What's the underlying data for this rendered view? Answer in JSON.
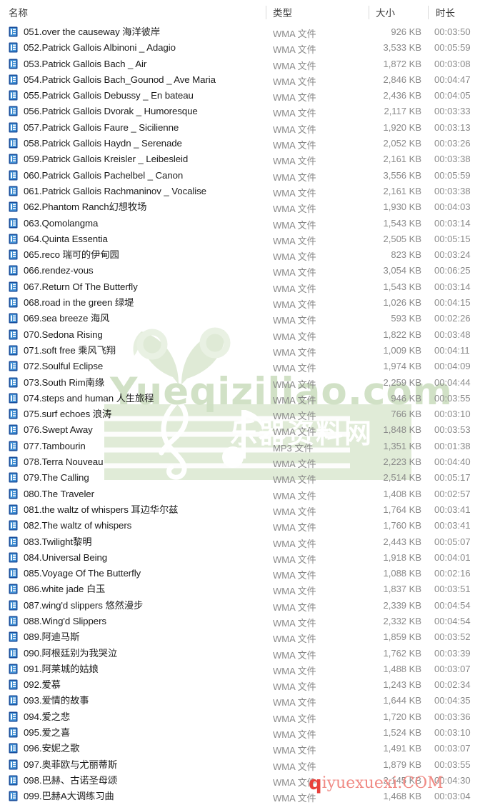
{
  "columns": {
    "name": "名称",
    "type": "类型",
    "size": "大小",
    "duration": "时长"
  },
  "icons": {
    "file": "wma-file-icon"
  },
  "colors": {
    "icon_blue_dark": "#1b4f9c",
    "icon_blue_light": "#4f9be0",
    "text_primary": "#1c1c1c",
    "text_secondary": "#8a8a8a",
    "watermark_green": "#cfe0c4",
    "watermark_band": "#dae7d0",
    "watermark_red": "#e8413c"
  },
  "watermark": {
    "center_text": "Yueqiziliao.com",
    "center_text_cn": "乐器资料网",
    "bottom_prefix": "q",
    "bottom_text": "iyuexuexi.COM"
  },
  "rows": [
    {
      "name": "051.over the causeway 海洋彼岸",
      "type": "WMA 文件",
      "size": "926 KB",
      "duration": "00:03:50"
    },
    {
      "name": "052.Patrick Gallois Albinoni _ Adagio",
      "type": "WMA 文件",
      "size": "3,533 KB",
      "duration": "00:05:59"
    },
    {
      "name": "053.Patrick Gallois Bach _ Air",
      "type": "WMA 文件",
      "size": "1,872 KB",
      "duration": "00:03:08"
    },
    {
      "name": "054.Patrick Gallois Bach_Gounod _ Ave Maria",
      "type": "WMA 文件",
      "size": "2,846 KB",
      "duration": "00:04:47"
    },
    {
      "name": "055.Patrick Gallois Debussy _ En bateau",
      "type": "WMA 文件",
      "size": "2,436 KB",
      "duration": "00:04:05"
    },
    {
      "name": "056.Patrick Gallois Dvorak _ Humoresque",
      "type": "WMA 文件",
      "size": "2,117 KB",
      "duration": "00:03:33"
    },
    {
      "name": "057.Patrick Gallois Faure _ Sicilienne",
      "type": "WMA 文件",
      "size": "1,920 KB",
      "duration": "00:03:13"
    },
    {
      "name": "058.Patrick Gallois Haydn _ Serenade",
      "type": "WMA 文件",
      "size": "2,052 KB",
      "duration": "00:03:26"
    },
    {
      "name": "059.Patrick Gallois Kreisler _ Leibesleid",
      "type": "WMA 文件",
      "size": "2,161 KB",
      "duration": "00:03:38"
    },
    {
      "name": "060.Patrick Gallois Pachelbel _ Canon",
      "type": "WMA 文件",
      "size": "3,556 KB",
      "duration": "00:05:59"
    },
    {
      "name": "061.Patrick Gallois Rachmaninov _ Vocalise",
      "type": "WMA 文件",
      "size": "2,161 KB",
      "duration": "00:03:38"
    },
    {
      "name": "062.Phantom Ranch幻想牧场",
      "type": "WMA 文件",
      "size": "1,930 KB",
      "duration": "00:04:03"
    },
    {
      "name": "063.Qomolangma",
      "type": "WMA 文件",
      "size": "1,543 KB",
      "duration": "00:03:14"
    },
    {
      "name": "064.Quinta Essentia",
      "type": "WMA 文件",
      "size": "2,505 KB",
      "duration": "00:05:15"
    },
    {
      "name": "065.reco 瑞可的伊甸园",
      "type": "WMA 文件",
      "size": "823 KB",
      "duration": "00:03:24"
    },
    {
      "name": "066.rendez-vous",
      "type": "WMA 文件",
      "size": "3,054 KB",
      "duration": "00:06:25"
    },
    {
      "name": "067.Return Of The Butterfly",
      "type": "WMA 文件",
      "size": "1,543 KB",
      "duration": "00:03:14"
    },
    {
      "name": "068.road in the green 绿堤",
      "type": "WMA 文件",
      "size": "1,026 KB",
      "duration": "00:04:15"
    },
    {
      "name": "069.sea breeze 海风",
      "type": "WMA 文件",
      "size": "593 KB",
      "duration": "00:02:26"
    },
    {
      "name": "070.Sedona Rising",
      "type": "WMA 文件",
      "size": "1,822 KB",
      "duration": "00:03:48"
    },
    {
      "name": "071.soft free 乘风飞翔",
      "type": "WMA 文件",
      "size": "1,009 KB",
      "duration": "00:04:11"
    },
    {
      "name": "072.Soulful Eclipse",
      "type": "WMA 文件",
      "size": "1,974 KB",
      "duration": "00:04:09"
    },
    {
      "name": "073.South Rim南缘",
      "type": "WMA 文件",
      "size": "2,259 KB",
      "duration": "00:04:44"
    },
    {
      "name": "074.steps and human 人生旅程",
      "type": "WMA 文件",
      "size": "946 KB",
      "duration": "00:03:55"
    },
    {
      "name": "075.surf echoes 浪涛",
      "type": "WMA 文件",
      "size": "766 KB",
      "duration": "00:03:10"
    },
    {
      "name": "076.Swept Away",
      "type": "WMA 文件",
      "size": "1,848 KB",
      "duration": "00:03:53"
    },
    {
      "name": "077.Tambourin",
      "type": "MP3 文件",
      "size": "1,351 KB",
      "duration": "00:01:38"
    },
    {
      "name": "078.Terra Nouveau",
      "type": "WMA 文件",
      "size": "2,223 KB",
      "duration": "00:04:40"
    },
    {
      "name": "079.The Calling",
      "type": "WMA 文件",
      "size": "2,514 KB",
      "duration": "00:05:17"
    },
    {
      "name": "080.The Traveler",
      "type": "WMA 文件",
      "size": "1,408 KB",
      "duration": "00:02:57"
    },
    {
      "name": "081.the waltz of whispers 耳边华尔兹",
      "type": "WMA 文件",
      "size": "1,764 KB",
      "duration": "00:03:41"
    },
    {
      "name": "082.The waltz of whispers",
      "type": "WMA 文件",
      "size": "1,760 KB",
      "duration": "00:03:41"
    },
    {
      "name": "083.Twilight黎明",
      "type": "WMA 文件",
      "size": "2,443 KB",
      "duration": "00:05:07"
    },
    {
      "name": "084.Universal Being",
      "type": "WMA 文件",
      "size": "1,918 KB",
      "duration": "00:04:01"
    },
    {
      "name": "085.Voyage Of The Butterfly",
      "type": "WMA 文件",
      "size": "1,088 KB",
      "duration": "00:02:16"
    },
    {
      "name": "086.white jade 白玉",
      "type": "WMA 文件",
      "size": "1,837 KB",
      "duration": "00:03:51"
    },
    {
      "name": "087.wing'd slippers 悠然漫步",
      "type": "WMA 文件",
      "size": "2,339 KB",
      "duration": "00:04:54"
    },
    {
      "name": "088.Wing'd Slippers",
      "type": "WMA 文件",
      "size": "2,332 KB",
      "duration": "00:04:54"
    },
    {
      "name": "089.阿迪马斯",
      "type": "WMA 文件",
      "size": "1,859 KB",
      "duration": "00:03:52"
    },
    {
      "name": "090.阿根廷别为我哭泣",
      "type": "WMA 文件",
      "size": "1,762 KB",
      "duration": "00:03:39"
    },
    {
      "name": "091.阿莱城的姑娘",
      "type": "WMA 文件",
      "size": "1,488 KB",
      "duration": "00:03:07"
    },
    {
      "name": "092.爱慕",
      "type": "WMA 文件",
      "size": "1,243 KB",
      "duration": "00:02:34"
    },
    {
      "name": "093.爱情的故事",
      "type": "WMA 文件",
      "size": "1,644 KB",
      "duration": "00:04:35"
    },
    {
      "name": "094.爱之悲",
      "type": "WMA 文件",
      "size": "1,720 KB",
      "duration": "00:03:36"
    },
    {
      "name": "095.爱之喜",
      "type": "WMA 文件",
      "size": "1,524 KB",
      "duration": "00:03:10"
    },
    {
      "name": "096.安妮之歌",
      "type": "WMA 文件",
      "size": "1,491 KB",
      "duration": "00:03:07"
    },
    {
      "name": "097.奥菲欧与尤丽蒂斯",
      "type": "WMA 文件",
      "size": "1,879 KB",
      "duration": "00:03:55"
    },
    {
      "name": "098.巴赫、古诺圣母颂",
      "type": "WMA 文件",
      "size": "2,145 KB",
      "duration": "00:04:30"
    },
    {
      "name": "099.巴赫A大调练习曲",
      "type": "WMA 文件",
      "size": "1,468 KB",
      "duration": "00:03:04"
    }
  ]
}
